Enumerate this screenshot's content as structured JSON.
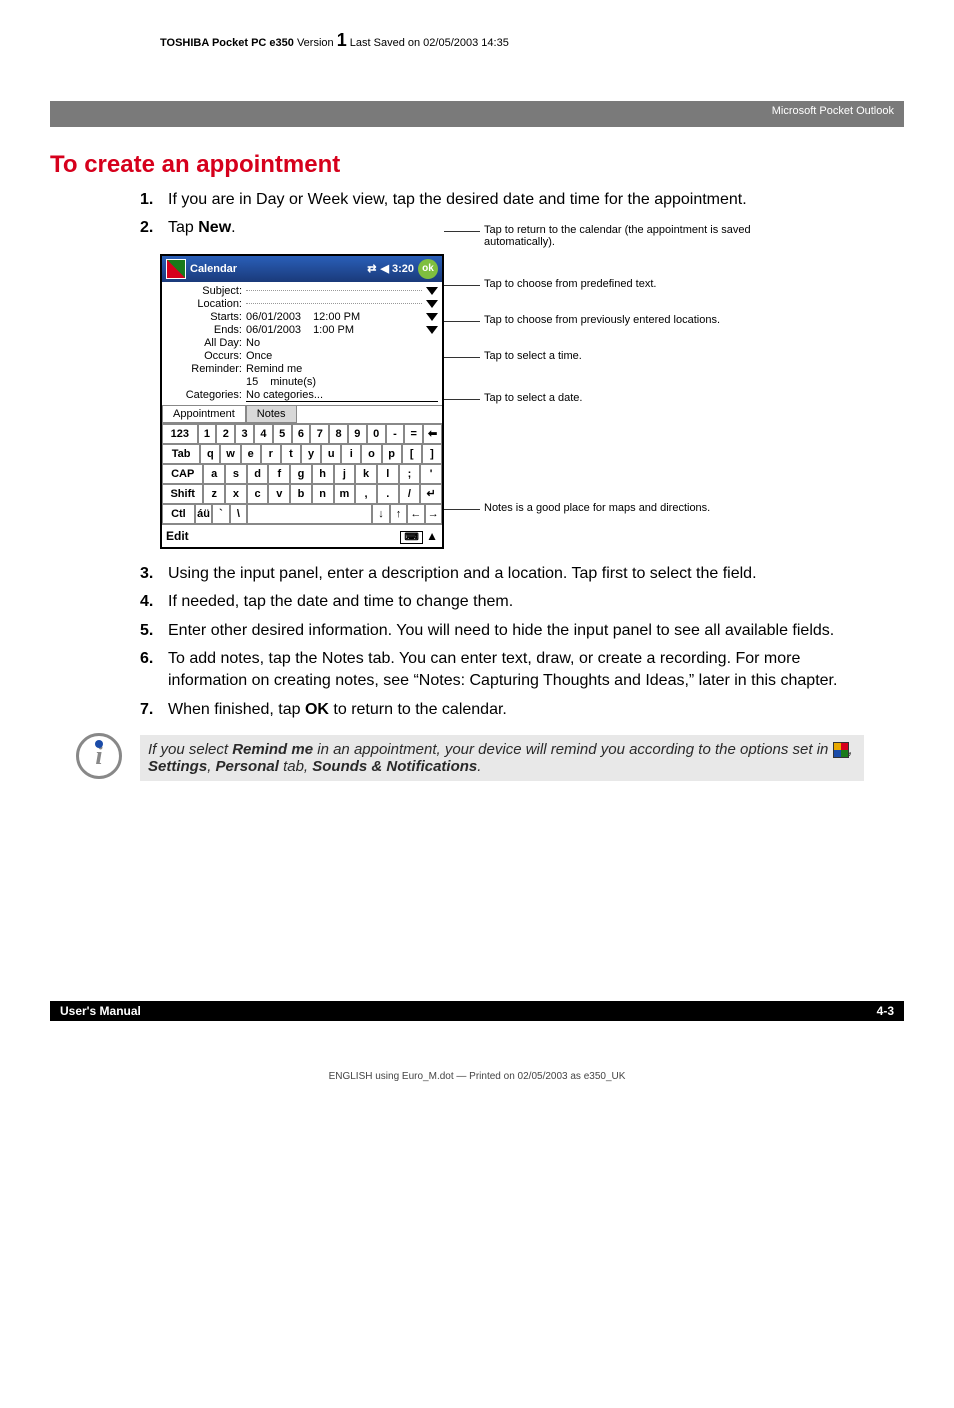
{
  "docHeader": {
    "prefix": "TOSHIBA Pocket PC e350",
    "versionWord": "Version",
    "versionNum": "1",
    "saved": "Last Saved on 02/05/2003 14:35"
  },
  "breadcrumb": "Microsoft Pocket Outlook",
  "sectionTitle": "To create an appointment",
  "steps": [
    {
      "n": "1.",
      "t": "If you are in Day or Week view, tap the desired date and time for the appointment."
    },
    {
      "n": "2.",
      "t": "Tap "
    },
    {
      "n": "3.",
      "t": "Using the input panel, enter a description and a location. Tap first to select the field."
    },
    {
      "n": "4.",
      "t": "If needed, tap the date and time to change them."
    },
    {
      "n": "5.",
      "t": "Enter other desired information. You will need to hide the input panel to see all available fields."
    },
    {
      "n": "6.",
      "t": "To add notes, tap the Notes tab. You can enter text, draw, or create a recording. For more information on creating notes, see “Notes: Capturing Thoughts and Ideas,” later in this chapter."
    },
    {
      "n": "7.",
      "t": "When finished, tap "
    }
  ],
  "step2bold": "New",
  "step2after": ".",
  "step7bold": "OK",
  "step7after": " to return to the calendar.",
  "ppc": {
    "appTitle": "Calendar",
    "clock": "3:20",
    "ok": "ok",
    "fields": {
      "subject": {
        "label": "Subject:",
        "value": ""
      },
      "location": {
        "label": "Location:",
        "value": ""
      },
      "starts": {
        "label": "Starts:",
        "date": "06/01/2003",
        "time": "12:00 PM"
      },
      "ends": {
        "label": "Ends:",
        "date": "06/01/2003",
        "time": "1:00 PM"
      },
      "allday": {
        "label": "All Day:",
        "value": "No"
      },
      "occurs": {
        "label": "Occurs:",
        "value": "Once"
      },
      "reminder": {
        "label": "Reminder:",
        "value": "Remind me"
      },
      "remindAmt": {
        "num": "15",
        "unit": "minute(s)"
      },
      "categories": {
        "label": "Categories:",
        "value": "No categories..."
      }
    },
    "tabs": {
      "appointment": "Appointment",
      "notes": "Notes"
    },
    "keyboard": {
      "row1": [
        "123",
        "1",
        "2",
        "3",
        "4",
        "5",
        "6",
        "7",
        "8",
        "9",
        "0",
        "-",
        "=",
        "⬅"
      ],
      "row2": [
        "Tab",
        "q",
        "w",
        "e",
        "r",
        "t",
        "y",
        "u",
        "i",
        "o",
        "p",
        "[",
        "]"
      ],
      "row3": [
        "CAP",
        "a",
        "s",
        "d",
        "f",
        "g",
        "h",
        "j",
        "k",
        "l",
        ";",
        "'"
      ],
      "row4": [
        "Shift",
        "z",
        "x",
        "c",
        "v",
        "b",
        "n",
        "m",
        ",",
        ".",
        "/",
        "↵"
      ],
      "row5": [
        "Ctl",
        "áü",
        "`",
        "\\",
        " ",
        "↓",
        "↑",
        "←",
        "→"
      ]
    },
    "bottom": {
      "edit": "Edit",
      "kb": "⌨",
      "arrow": "▲"
    }
  },
  "callouts": {
    "c1": "Tap to return to the calendar (the appointment is saved automatically).",
    "c2": "Tap to choose from predefined text.",
    "c3": "Tap to choose from previously entered locations.",
    "c4": "Tap to select a time.",
    "c5": "Tap to select a date.",
    "c6": "Notes is a good place for maps and directions."
  },
  "note": {
    "pre": "If you select ",
    "b1": "Remind me",
    "mid1": " in an appointment, your device will remind you according to the options set in ",
    "b2": "Settings",
    "mid2": ", ",
    "b3": "Personal",
    "mid3": " tab, ",
    "b4": "Sounds & Notifications",
    "end": "."
  },
  "footer": {
    "left": "User's Manual",
    "right": "4-3"
  },
  "printLine": "ENGLISH using Euro_M.dot — Printed on 02/05/2003 as e350_UK"
}
